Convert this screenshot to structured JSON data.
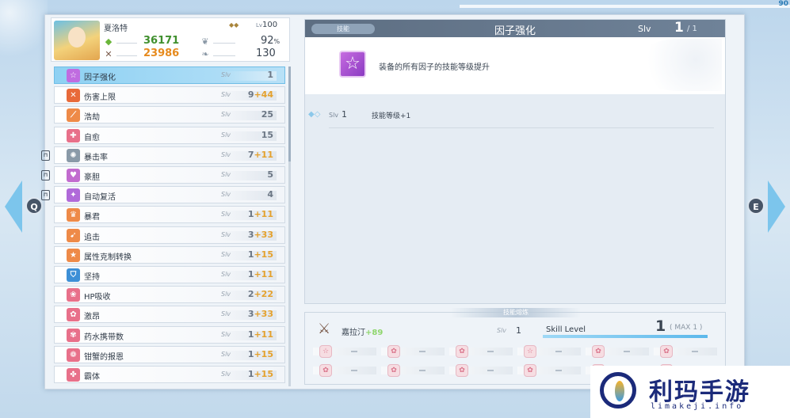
{
  "corner_number": "90",
  "nav": {
    "left_key": "Q",
    "right_key": "E"
  },
  "character": {
    "name": "夏洛特",
    "level_prefix": "Lv",
    "level": "100",
    "stats": [
      {
        "icon": "green-gem-icon",
        "value": "36171",
        "color": "#3f8f2d"
      },
      {
        "icon": "sword-icon",
        "value": "23986",
        "color": "#e68a1d"
      },
      {
        "icon": "shield-wing-icon",
        "value": "92",
        "unit": "%"
      },
      {
        "icon": "feather-wing-icon",
        "value": "130"
      }
    ]
  },
  "skills": [
    {
      "name": "因子强化",
      "level": "1",
      "bonus": "",
      "icon_color": "#c06ce0",
      "icon": "star-icon",
      "selected": true,
      "locked": false
    },
    {
      "name": "伤害上限",
      "level": "9",
      "bonus": "+44",
      "icon_color": "#e86a3a",
      "icon": "sword-cross-icon",
      "selected": false,
      "locked": false
    },
    {
      "name": "浩劫",
      "level": "25",
      "bonus": "",
      "icon_color": "#ee8a48",
      "icon": "blade-icon",
      "selected": false,
      "locked": false
    },
    {
      "name": "自愈",
      "level": "15",
      "bonus": "",
      "icon_color": "#e8708a",
      "icon": "heal-icon",
      "selected": false,
      "locked": false
    },
    {
      "name": "暴击率",
      "level": "7",
      "bonus": "+11",
      "icon_color": "#8a9aa8",
      "icon": "crit-icon",
      "selected": false,
      "locked": true
    },
    {
      "name": "豪胆",
      "level": "5",
      "bonus": "",
      "icon_color": "#c26ccf",
      "icon": "heart-icon",
      "selected": false,
      "locked": true
    },
    {
      "name": "自动复活",
      "level": "4",
      "bonus": "",
      "icon_color": "#b06ad9",
      "icon": "revive-icon",
      "selected": false,
      "locked": true
    },
    {
      "name": "暴君",
      "level": "1",
      "bonus": "+11",
      "icon_color": "#ee8a48",
      "icon": "tyrant-icon",
      "selected": false,
      "locked": false
    },
    {
      "name": "追击",
      "level": "3",
      "bonus": "+33",
      "icon_color": "#ee8a48",
      "icon": "chase-icon",
      "selected": false,
      "locked": false
    },
    {
      "name": "属性克制转换",
      "level": "1",
      "bonus": "+15",
      "icon_color": "#ee8a48",
      "icon": "element-icon",
      "selected": false,
      "locked": false
    },
    {
      "name": "坚持",
      "level": "1",
      "bonus": "+11",
      "icon_color": "#3d8fd6",
      "icon": "shield-icon",
      "selected": false,
      "locked": false
    },
    {
      "name": "HP吸收",
      "level": "2",
      "bonus": "+22",
      "icon_color": "#e8708a",
      "icon": "hp-drain-icon",
      "selected": false,
      "locked": false
    },
    {
      "name": "激昂",
      "level": "3",
      "bonus": "+33",
      "icon_color": "#e8708a",
      "icon": "fervor-icon",
      "selected": false,
      "locked": false
    },
    {
      "name": "药水携带数",
      "level": "1",
      "bonus": "+11",
      "icon_color": "#e8708a",
      "icon": "potion-icon",
      "selected": false,
      "locked": false
    },
    {
      "name": "钳蟹的报恩",
      "level": "1",
      "bonus": "+15",
      "icon_color": "#e8708a",
      "icon": "crab-icon",
      "selected": false,
      "locked": false
    },
    {
      "name": "霸体",
      "level": "1",
      "bonus": "+15",
      "icon_color": "#e8708a",
      "icon": "armor-icon",
      "selected": false,
      "locked": false
    }
  ],
  "slv_label": "Slv",
  "detail": {
    "tag": "技能",
    "title": "因子强化",
    "slv_label": "Slv",
    "level": "1",
    "max": "/ 1",
    "description": "装备的所有因子的技能等级提升",
    "level_rows": [
      {
        "slv": "Slv",
        "level": "1",
        "text": "技能等级+1"
      }
    ]
  },
  "materials": {
    "tab": "技能熔炼",
    "source_name": "嘉拉汀",
    "source_bonus": "+89",
    "slv_label": "Slv",
    "slv_value": "1",
    "skill_level_label": "Skill Level",
    "skill_level_value": "1",
    "max_label": "( MAX  1 )",
    "slots": [
      {
        "icon": "star-material-icon",
        "value": "-"
      },
      {
        "icon": "pink-material-icon",
        "value": "-"
      },
      {
        "icon": "pink-material-icon",
        "value": "-"
      },
      {
        "icon": "star-material-icon",
        "value": "-"
      },
      {
        "icon": "pink-material-icon",
        "value": "-"
      },
      {
        "icon": "pink-material-icon",
        "value": "-"
      },
      {
        "icon": "pink-material-icon",
        "value": "-"
      },
      {
        "icon": "pink-material-icon",
        "value": "-"
      },
      {
        "icon": "pink-material-icon",
        "value": "-"
      },
      {
        "icon": "pink-material-icon",
        "value": "-"
      },
      {
        "icon": "pink-material-icon",
        "value": "-"
      },
      {
        "icon": "pink-material-icon",
        "value": "-"
      }
    ]
  },
  "watermark": {
    "text_cn": "利玛手游",
    "text_en": "limakeji.info"
  }
}
